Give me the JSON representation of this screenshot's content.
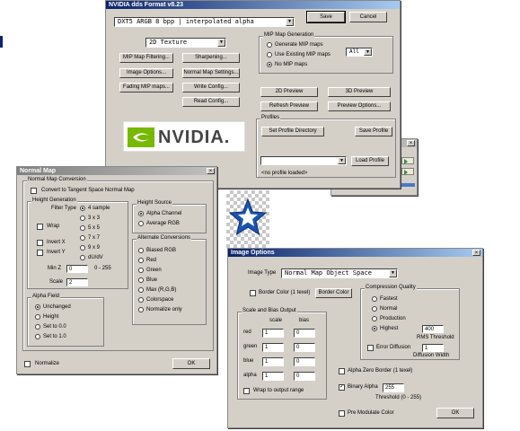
{
  "colors": {
    "titlebar_active": "#0a246a",
    "titlebar_inactive": "#808080",
    "dialog_face": "#d4d0c8",
    "nvidia_green": "#76b900"
  },
  "dds": {
    "title": "NVIDIA dds Format v8.23",
    "format_value": "DXT5         ARGB   8 bpp | interpolated alpha",
    "save": "Save",
    "cancel": "Cancel",
    "texture_type": "2D Texture",
    "buttons": {
      "mip_filtering": "MIP Map Filtering...",
      "sharpening": "Sharpening...",
      "image_options": "Image Options...",
      "normal_map_settings": "Normal Map Settings...",
      "fading_mip": "Fading MIP maps...",
      "write_config": "Write Config...",
      "read_config": "Read Config..."
    },
    "mip_group": "MIP Map Generation",
    "mip_opts": [
      "Generate MIP maps",
      "Use Existing MIP maps",
      "No MIP maps"
    ],
    "mip_count": "All",
    "preview_2d": "2D Preview",
    "preview_3d": "3D Preview",
    "refresh_preview": "Refresh Preview",
    "preview_options": "Preview Options...",
    "profiles_group": "Profiles",
    "set_profile_dir": "Set Profile Directory",
    "save_profile": "Save Profile",
    "load_profile": "Load Profile",
    "no_profile": "<no profile loaded>",
    "logo_text": "NVIDIA."
  },
  "normal_map": {
    "title": "Normal Map",
    "conversion_group": "Normal Map Conversion",
    "convert_tangent": "Convert to Tangent Space Normal Map",
    "height_gen_group": "Height Generation",
    "filter_type": "Filter Type",
    "filters": [
      "4 sample",
      "3 x 3",
      "5 x 5",
      "7 x 7",
      "9 x 9",
      "dU/dV"
    ],
    "wrap": "Wrap",
    "invert_x": "Invert X",
    "invert_y": "Invert Y",
    "min_z_label": "Min Z",
    "min_z_value": "0",
    "min_z_range": "0 - 255",
    "scale_label": "Scale",
    "scale_value": "2",
    "height_source_group": "Height Source",
    "height_sources": [
      "Alpha Channel",
      "Average RGB"
    ],
    "alt_conv_group": "Alternate Conversions",
    "alt_convs": [
      "Biased RGB",
      "Red",
      "Green",
      "Blue",
      "Max (R,G,B)",
      "Colorspace",
      "Normalize only"
    ],
    "alpha_field_group": "Alpha Field",
    "alpha_fields": [
      "Unchanged",
      "Height",
      "Set to 0.0",
      "Set to 1.0"
    ],
    "normalize": "Normalize",
    "ok": "OK"
  },
  "image_options": {
    "title": "Image Options",
    "image_type_label": "Image Type",
    "image_type_value": "Normal Map  Object Space",
    "border_color_1texel": "Border Color (1 texel)",
    "border_color_btn": "Border Color",
    "compression_group": "Compression Quality",
    "qualities": [
      "Fastest",
      "Normal",
      "Production",
      "Highest"
    ],
    "rms_value": "400",
    "rms_label": "RMS Threshold",
    "error_diffusion": "Error Diffusion",
    "diffusion_value": "1",
    "diffusion_label": "Diffusion Width",
    "scale_bias_group": "Scale and Bias Output",
    "scale_col": "scale",
    "bias_col": "bias",
    "rows": [
      {
        "label": "red",
        "scale": "1",
        "bias": "0"
      },
      {
        "label": "green",
        "scale": "1",
        "bias": "0"
      },
      {
        "label": "blue",
        "scale": "1",
        "bias": "0"
      },
      {
        "label": "alpha",
        "scale": "1",
        "bias": "0"
      }
    ],
    "wrap_output": "Wrap to output range",
    "alpha_zero_border": "Alpha Zero Border (1 texel)",
    "binary_alpha": "Binary Alpha",
    "threshold_value": "255",
    "threshold_label": "Threshold (0 - 255)",
    "pre_modulate": "Pre Modulate Color",
    "ok": "OK"
  },
  "bg_window": {
    "rows": [
      "",
      "",
      ""
    ]
  }
}
